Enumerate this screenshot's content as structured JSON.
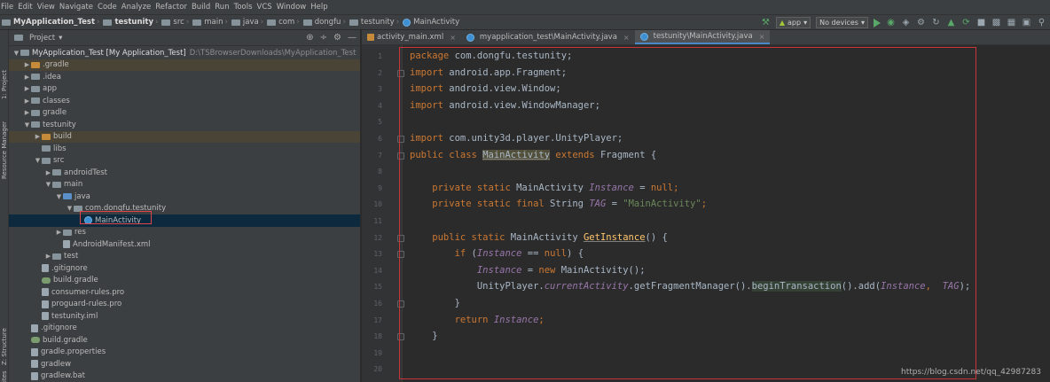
{
  "menu": [
    "File",
    "Edit",
    "View",
    "Navigate",
    "Code",
    "Analyze",
    "Refactor",
    "Build",
    "Run",
    "Tools",
    "VCS",
    "Window",
    "Help"
  ],
  "breadcrumbs": [
    "MyApplication_Test",
    "testunity",
    "src",
    "main",
    "java",
    "com",
    "dongfu",
    "testunity",
    "MainActivity"
  ],
  "toolbar": {
    "app_config": "app",
    "device": "No devices"
  },
  "stripe": {
    "project": "1: Project",
    "resource_manager": "Resource Manager",
    "structure": "Z: Structure",
    "favorites": "ites"
  },
  "project_panel": {
    "title": "Project",
    "tree": [
      {
        "label": "MyApplication_Test [My Application_Test]",
        "extra": "D:\\TSBrowserDownloads\\MyApplication_Test",
        "depth": 0,
        "arrow": "down",
        "icon": "folder",
        "state": ""
      },
      {
        "label": ".gradle",
        "depth": 1,
        "arrow": "right",
        "icon": "folder-orange",
        "state": "hl"
      },
      {
        "label": ".idea",
        "depth": 1,
        "arrow": "right",
        "icon": "folder",
        "state": ""
      },
      {
        "label": "app",
        "depth": 1,
        "arrow": "right",
        "icon": "folder",
        "state": ""
      },
      {
        "label": "classes",
        "depth": 1,
        "arrow": "right",
        "icon": "folder",
        "state": ""
      },
      {
        "label": "gradle",
        "depth": 1,
        "arrow": "right",
        "icon": "folder",
        "state": ""
      },
      {
        "label": "testunity",
        "depth": 1,
        "arrow": "down",
        "icon": "folder",
        "state": ""
      },
      {
        "label": "build",
        "depth": 2,
        "arrow": "right",
        "icon": "folder-orange",
        "state": "hl"
      },
      {
        "label": "libs",
        "depth": 2,
        "arrow": "",
        "icon": "folder",
        "state": ""
      },
      {
        "label": "src",
        "depth": 2,
        "arrow": "down",
        "icon": "folder",
        "state": ""
      },
      {
        "label": "androidTest",
        "depth": 3,
        "arrow": "right",
        "icon": "folder",
        "state": ""
      },
      {
        "label": "main",
        "depth": 3,
        "arrow": "down",
        "icon": "folder",
        "state": ""
      },
      {
        "label": "java",
        "depth": 4,
        "arrow": "down",
        "icon": "folder-blue",
        "state": ""
      },
      {
        "label": "com.dongfu.testunity",
        "depth": 5,
        "arrow": "down",
        "icon": "folder",
        "state": ""
      },
      {
        "label": "MainActivity",
        "depth": 6,
        "arrow": "",
        "icon": "class",
        "state": "sel"
      },
      {
        "label": "res",
        "depth": 4,
        "arrow": "right",
        "icon": "folder",
        "state": ""
      },
      {
        "label": "AndroidManifest.xml",
        "depth": 4,
        "arrow": "",
        "icon": "file",
        "state": ""
      },
      {
        "label": "test",
        "depth": 3,
        "arrow": "right",
        "icon": "folder",
        "state": ""
      },
      {
        "label": ".gitignore",
        "depth": 2,
        "arrow": "",
        "icon": "file",
        "state": ""
      },
      {
        "label": "build.gradle",
        "depth": 2,
        "arrow": "",
        "icon": "gradle",
        "state": ""
      },
      {
        "label": "consumer-rules.pro",
        "depth": 2,
        "arrow": "",
        "icon": "file",
        "state": ""
      },
      {
        "label": "proguard-rules.pro",
        "depth": 2,
        "arrow": "",
        "icon": "file",
        "state": ""
      },
      {
        "label": "testunity.iml",
        "depth": 2,
        "arrow": "",
        "icon": "file",
        "state": ""
      },
      {
        "label": ".gitignore",
        "depth": 1,
        "arrow": "",
        "icon": "file",
        "state": ""
      },
      {
        "label": "build.gradle",
        "depth": 1,
        "arrow": "",
        "icon": "gradle",
        "state": ""
      },
      {
        "label": "gradle.properties",
        "depth": 1,
        "arrow": "",
        "icon": "file",
        "state": ""
      },
      {
        "label": "gradlew",
        "depth": 1,
        "arrow": "",
        "icon": "file",
        "state": ""
      },
      {
        "label": "gradlew.bat",
        "depth": 1,
        "arrow": "",
        "icon": "file",
        "state": ""
      }
    ]
  },
  "tabs": [
    {
      "label": "activity_main.xml",
      "icon": "xml",
      "active": false
    },
    {
      "label": "myapplication_test\\MainActivity.java",
      "icon": "class",
      "active": false
    },
    {
      "label": "testunity\\MainActivity.java",
      "icon": "class",
      "active": true
    }
  ],
  "code_lines": [
    [
      {
        "t": "package",
        "c": "kw"
      },
      {
        "t": " com.dongfu.testunity;",
        "c": ""
      }
    ],
    [
      {
        "t": "import",
        "c": "kw"
      },
      {
        "t": " android.app.Fragment;",
        "c": ""
      }
    ],
    [
      {
        "t": "import",
        "c": "kw"
      },
      {
        "t": " android.view.Window;",
        "c": ""
      }
    ],
    [
      {
        "t": "import",
        "c": "kw"
      },
      {
        "t": " android.view.WindowManager;",
        "c": ""
      }
    ],
    [],
    [
      {
        "t": "import",
        "c": "kw"
      },
      {
        "t": " com.unity3d.player.UnityPlayer;",
        "c": ""
      }
    ],
    [
      {
        "t": "public class ",
        "c": "kw"
      },
      {
        "t": "MainActivity",
        "c": "hlcls und"
      },
      {
        "t": " extends ",
        "c": "kw"
      },
      {
        "t": "Fragment {",
        "c": ""
      }
    ],
    [],
    [
      {
        "t": "    private static ",
        "c": "kw"
      },
      {
        "t": "MainActivity ",
        "c": ""
      },
      {
        "t": "Instance",
        "c": "it"
      },
      {
        "t": " = ",
        "c": ""
      },
      {
        "t": "null",
        "c": "kw"
      },
      {
        "t": ";",
        "c": "kw"
      }
    ],
    [
      {
        "t": "    private static final ",
        "c": "kw"
      },
      {
        "t": "String ",
        "c": ""
      },
      {
        "t": "TAG",
        "c": "it"
      },
      {
        "t": " = ",
        "c": ""
      },
      {
        "t": "\"MainActivity\"",
        "c": "str"
      },
      {
        "t": ";",
        "c": "kw"
      }
    ],
    [],
    [
      {
        "t": "    public static ",
        "c": "kw"
      },
      {
        "t": "MainActivity ",
        "c": ""
      },
      {
        "t": "GetInstance",
        "c": "fn und"
      },
      {
        "t": "() {",
        "c": ""
      }
    ],
    [
      {
        "t": "        if ",
        "c": "kw"
      },
      {
        "t": "(",
        "c": ""
      },
      {
        "t": "Instance",
        "c": "it"
      },
      {
        "t": " == ",
        "c": ""
      },
      {
        "t": "null",
        "c": "kw"
      },
      {
        "t": ") {",
        "c": ""
      }
    ],
    [
      {
        "t": "            ",
        "c": ""
      },
      {
        "t": "Instance",
        "c": "it"
      },
      {
        "t": " = ",
        "c": ""
      },
      {
        "t": "new ",
        "c": "kw"
      },
      {
        "t": "MainActivity();",
        "c": ""
      }
    ],
    [
      {
        "t": "            UnityPlayer.",
        "c": ""
      },
      {
        "t": "currentActivity",
        "c": "it"
      },
      {
        "t": ".getFragmentManager().",
        "c": ""
      },
      {
        "t": "beginTransaction",
        "c": "hlbg"
      },
      {
        "t": "().add(",
        "c": ""
      },
      {
        "t": "Instance",
        "c": "it"
      },
      {
        "t": ",  ",
        "c": "kw"
      },
      {
        "t": "TAG",
        "c": "it"
      },
      {
        "t": ");",
        "c": ""
      }
    ],
    [
      {
        "t": "        }",
        "c": ""
      }
    ],
    [
      {
        "t": "        return ",
        "c": "kw"
      },
      {
        "t": "Instance",
        "c": "it"
      },
      {
        "t": ";",
        "c": "kw"
      }
    ],
    [
      {
        "t": "    }",
        "c": ""
      }
    ],
    [],
    []
  ],
  "line_numbers": [
    "1",
    "2",
    "3",
    "4",
    "5",
    "6",
    "7",
    "8",
    "9",
    "10",
    "11",
    "12",
    "13",
    "14",
    "15",
    "16",
    "17",
    "18",
    "19",
    "20"
  ],
  "watermark": "https://blog.csdn.net/qq_42987283"
}
